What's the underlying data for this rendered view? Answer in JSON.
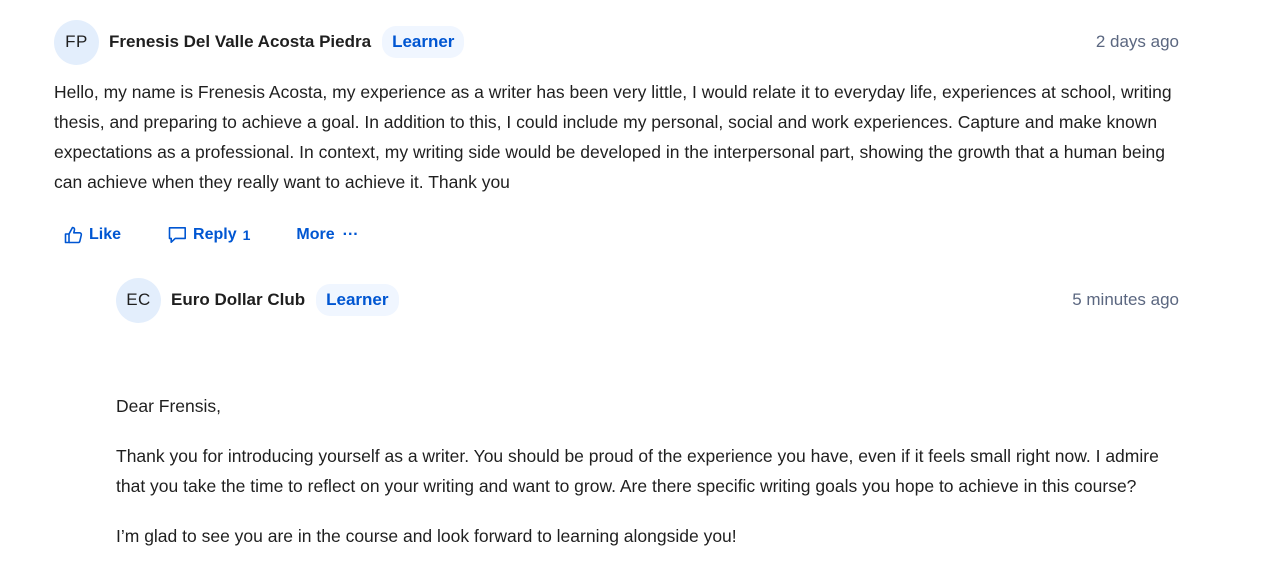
{
  "post": {
    "avatar_initials": "FP",
    "author": "Frenesis Del Valle Acosta Piedra",
    "badge": "Learner",
    "time": "2 days ago",
    "body": "Hello, my name is Frenesis Acosta, my experience as a writer has been very little, I would relate it to everyday life, experiences at school, writing thesis, and preparing to achieve a goal. In addition to this, I could include my personal, social and work experiences. Capture and make known expectations as a professional. In context, my writing side would be developed in the interpersonal part, showing the growth that a human being can achieve when they really want to achieve it. Thank you",
    "actions": {
      "like_label": "Like",
      "reply_label": "Reply",
      "reply_count": "1",
      "more_label": "More",
      "more_glyph": "···"
    }
  },
  "reply": {
    "avatar_initials": "EC",
    "author": "Euro Dollar Club",
    "badge": "Learner",
    "time": "5 minutes ago",
    "greeting": "Dear Frensis,",
    "paragraph_1": "Thank you for introducing yourself as a writer. You should be proud of the experience you have, even if it feels small right now. I admire that you take the time to reflect on your writing and want to grow. Are there specific writing goals you hope to achieve in this course?",
    "paragraph_2": "I’m glad to see you are in the course and look forward to learning alongside you!"
  },
  "icons": {
    "like": "thumbs-up-icon",
    "reply": "speech-bubble-icon",
    "more": "ellipsis-icon"
  },
  "colors": {
    "accent": "#0056d2",
    "badge_bg": "#f0f6ff",
    "avatar_bg": "#e3eefc",
    "muted_text": "#5b6780"
  }
}
